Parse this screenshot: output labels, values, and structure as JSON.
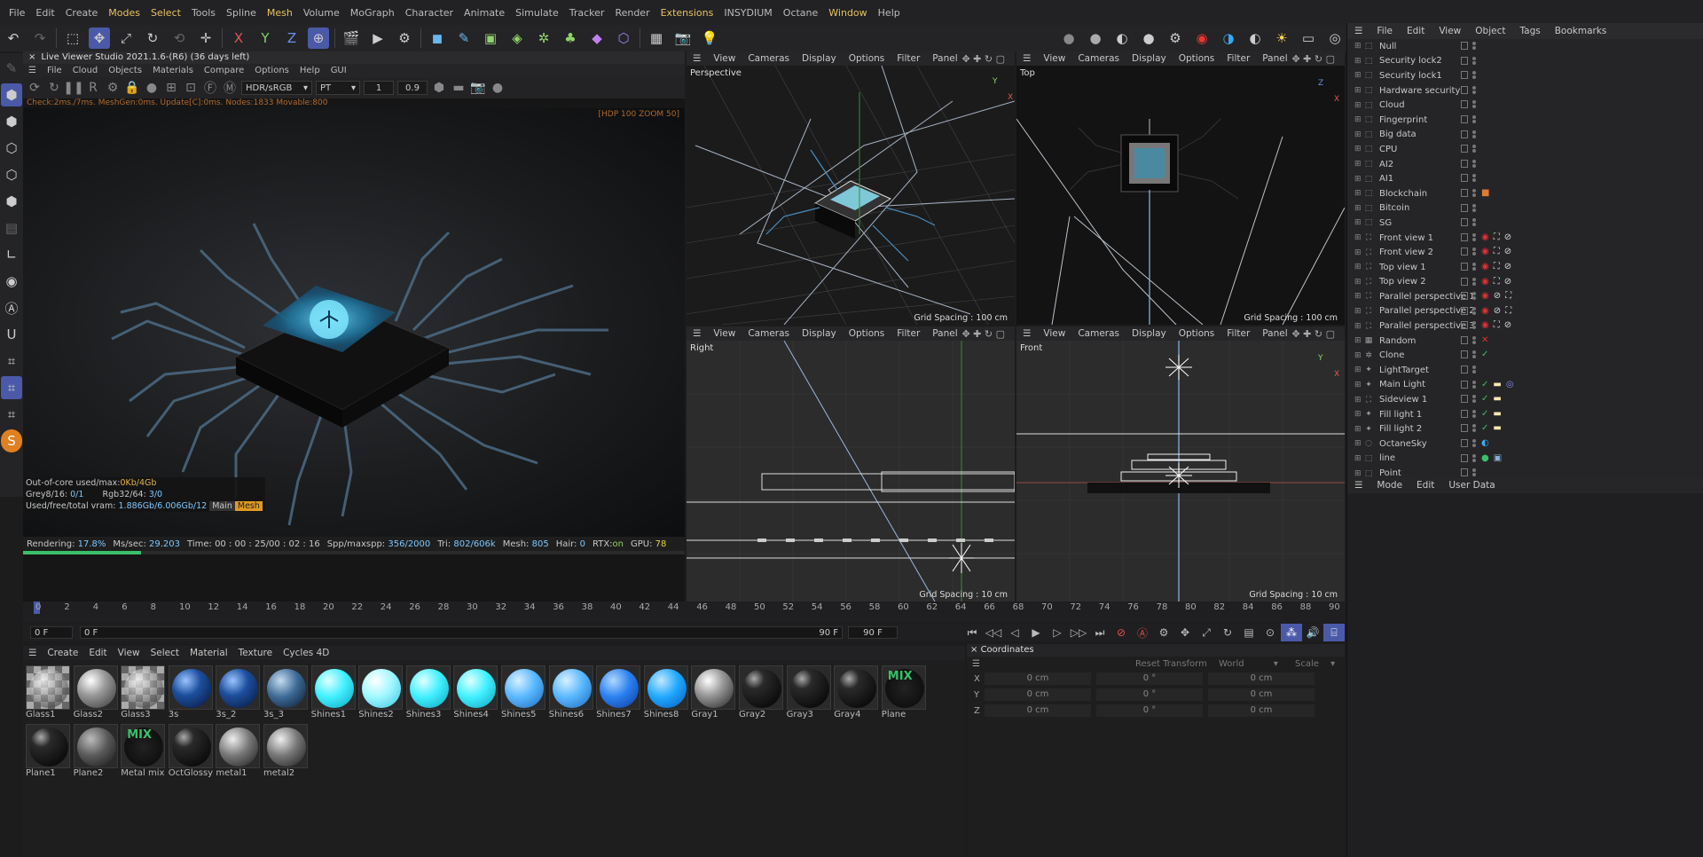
{
  "menu": [
    "File",
    "Edit",
    "Create",
    "Modes",
    "Select",
    "Tools",
    "Spline",
    "Mesh",
    "Volume",
    "MoGraph",
    "Character",
    "Animate",
    "Simulate",
    "Tracker",
    "Render",
    "Extensions",
    "INSYDIUM",
    "Octane",
    "Window",
    "Help"
  ],
  "menu_highlighted": [
    "Modes",
    "Select",
    "Mesh",
    "Extensions",
    "Window"
  ],
  "toolbar": {
    "x_axis": "X",
    "y_axis": "Y",
    "z_axis": "Z"
  },
  "live_viewer": {
    "title": "Live Viewer Studio 2021.1.6-(R6) (36 days left)",
    "menu": [
      "File",
      "Cloud",
      "Objects",
      "Materials",
      "Compare",
      "Options",
      "Help",
      "GUI"
    ],
    "colorspace": "HDR/sRGB",
    "kernel": "PT",
    "val1": "1",
    "val2": "0.9",
    "status": "Check:2ms./7ms. MeshGen:0ms. Update[C]:0ms. Nodes:1833 Movable:800",
    "zoom_text": "[HDP 100 ZOOM 50]",
    "info": {
      "ooc_label": "Out-of-core used/max:",
      "ooc_value": "0Kb/4Gb",
      "grey_label": "Grey8/16:",
      "grey_value": "0/1",
      "rgb_label": "Rgb32/64:",
      "rgb_value": "3/0",
      "vram_label": "Used/free/total vram:",
      "vram_value": "1.886Gb/6.006Gb/12",
      "main_tag": "Main",
      "second_tag": "Mesh"
    },
    "bottom": {
      "rendering_label": "Rendering:",
      "rendering": "17.8%",
      "ms_label": "Ms/sec:",
      "ms": "29.203",
      "time_label": "Time:",
      "time": "00 : 00 : 25/00 : 02 : 16",
      "spp_label": "Spp/maxspp:",
      "spp": "356/2000",
      "tri_label": "Tri:",
      "tri": "802/606k",
      "mesh_label": "Mesh:",
      "mesh": "805",
      "hair_label": "Hair:",
      "hair": "0",
      "rtx_label": "RTX:",
      "rtx": "on",
      "gpu_label": "GPU:",
      "gpu": "78"
    },
    "progress": 0.178
  },
  "viewport_menu": [
    "View",
    "Cameras",
    "Display",
    "Options",
    "Filter",
    "Panel"
  ],
  "viewports": [
    {
      "name": "Perspective",
      "grid": "Grid Spacing : 100 cm"
    },
    {
      "name": "Top",
      "grid": "Grid Spacing : 100 cm"
    },
    {
      "name": "Right",
      "grid": "Grid Spacing : 10 cm"
    },
    {
      "name": "Front",
      "grid": "Grid Spacing : 10 cm"
    }
  ],
  "timeline": {
    "ticks": [
      "0",
      "2",
      "4",
      "6",
      "8",
      "10",
      "12",
      "14",
      "16",
      "18",
      "20",
      "22",
      "24",
      "26",
      "28",
      "30",
      "32",
      "34",
      "36",
      "38",
      "40",
      "42",
      "44",
      "46",
      "48",
      "50",
      "52",
      "54",
      "56",
      "58",
      "60",
      "62",
      "64",
      "66",
      "68",
      "70",
      "72",
      "74",
      "76",
      "78",
      "80",
      "82",
      "84",
      "86",
      "88",
      "90"
    ],
    "current": "0 F",
    "start": "0 F",
    "end_a": "90 F",
    "end_b": "90 F"
  },
  "material_manager": {
    "menu": [
      "Create",
      "Edit",
      "View",
      "Select",
      "Material",
      "Texture",
      "Cycles 4D"
    ],
    "materials": [
      {
        "name": "Glass1",
        "kind": "checker"
      },
      {
        "name": "Glass2",
        "kind": "glass"
      },
      {
        "name": "Glass3",
        "kind": "checker"
      },
      {
        "name": "3s",
        "kind": "blue_dark"
      },
      {
        "name": "3s_2",
        "kind": "blue_dark"
      },
      {
        "name": "3s_3",
        "kind": "blue_steel"
      },
      {
        "name": "Shines1",
        "kind": "cyan"
      },
      {
        "name": "Shines2",
        "kind": "cyan_light"
      },
      {
        "name": "Shines3",
        "kind": "cyan"
      },
      {
        "name": "Shines4",
        "kind": "cyan"
      },
      {
        "name": "Shines5",
        "kind": "sky"
      },
      {
        "name": "Shines6",
        "kind": "sky"
      },
      {
        "name": "Shines7",
        "kind": "blue_bright"
      },
      {
        "name": "Shines8",
        "kind": "sky_bright"
      },
      {
        "name": "Gray1",
        "kind": "gray_shiny"
      },
      {
        "name": "Gray2",
        "kind": "black"
      },
      {
        "name": "Gray3",
        "kind": "black"
      },
      {
        "name": "Gray4",
        "kind": "black"
      },
      {
        "name": "Plane",
        "kind": "mix"
      },
      {
        "name": "Plane1",
        "kind": "black"
      },
      {
        "name": "Plane2",
        "kind": "gray"
      },
      {
        "name": "Metal mix",
        "kind": "mix"
      },
      {
        "name": "OctGlossy",
        "kind": "black"
      },
      {
        "name": "metal1",
        "kind": "metal"
      },
      {
        "name": "metal2",
        "kind": "metal"
      }
    ],
    "mix_text": "MIX"
  },
  "coordinates": {
    "title": "Coordinates",
    "reset": "Reset Transform",
    "space": "World",
    "mode": "Scale",
    "rows": [
      {
        "axis": "X",
        "pos": "0 cm",
        "rot": "0 °",
        "size": "0 cm"
      },
      {
        "axis": "Y",
        "pos": "0 cm",
        "rot": "0 °",
        "size": "0 cm"
      },
      {
        "axis": "Z",
        "pos": "0 cm",
        "rot": "0 °",
        "size": "0 cm"
      }
    ]
  },
  "object_manager": {
    "menu": [
      "File",
      "Edit",
      "View",
      "Object",
      "Tags",
      "Bookmarks"
    ],
    "objects": [
      {
        "name": "Null",
        "tags": []
      },
      {
        "name": "Security lock2",
        "tags": []
      },
      {
        "name": "Security lock1",
        "tags": []
      },
      {
        "name": "Hardware security",
        "tags": []
      },
      {
        "name": "Cloud",
        "tags": []
      },
      {
        "name": "Fingerprint",
        "tags": []
      },
      {
        "name": "Big data",
        "tags": []
      },
      {
        "name": "CPU",
        "tags": []
      },
      {
        "name": "AI2",
        "tags": []
      },
      {
        "name": "AI1",
        "tags": []
      },
      {
        "name": "Blockchain",
        "tags": [
          "orange-tag"
        ]
      },
      {
        "name": "Bitcoin",
        "tags": []
      },
      {
        "name": "SG",
        "tags": []
      },
      {
        "name": "Front view 1",
        "tags": [
          "target",
          "camera",
          "protect"
        ]
      },
      {
        "name": "Front view 2",
        "tags": [
          "target",
          "camera",
          "protect"
        ]
      },
      {
        "name": "Top view 1",
        "tags": [
          "target",
          "camera",
          "protect"
        ]
      },
      {
        "name": "Top view 2",
        "tags": [
          "target",
          "camera",
          "protect"
        ]
      },
      {
        "name": "Parallel perspective 1",
        "tags": [
          "target",
          "protect",
          "camera"
        ]
      },
      {
        "name": "Parallel perspective 2",
        "tags": [
          "target",
          "protect",
          "camera"
        ]
      },
      {
        "name": "Parallel perspective 3",
        "tags": [
          "target",
          "camera",
          "protect"
        ]
      },
      {
        "name": "Random",
        "tags": [
          "x-red"
        ]
      },
      {
        "name": "Clone",
        "tags": [
          "check-green"
        ]
      },
      {
        "name": "LightTarget",
        "tags": []
      },
      {
        "name": "Main Light",
        "tags": [
          "check-green",
          "light",
          "target-blue"
        ]
      },
      {
        "name": "Sideview 1",
        "tags": [
          "check-green",
          "light"
        ]
      },
      {
        "name": "Fill light 1",
        "tags": [
          "check-green",
          "light"
        ]
      },
      {
        "name": "Fill light 2",
        "tags": [
          "check-green",
          "light"
        ]
      },
      {
        "name": "OctaneSky",
        "tags": [
          "sky"
        ]
      },
      {
        "name": "line",
        "tags": [
          "green-ball",
          "material"
        ]
      },
      {
        "name": "Point",
        "tags": []
      }
    ]
  },
  "attribute_manager": {
    "menu": [
      "Mode",
      "Edit",
      "User Data"
    ]
  }
}
